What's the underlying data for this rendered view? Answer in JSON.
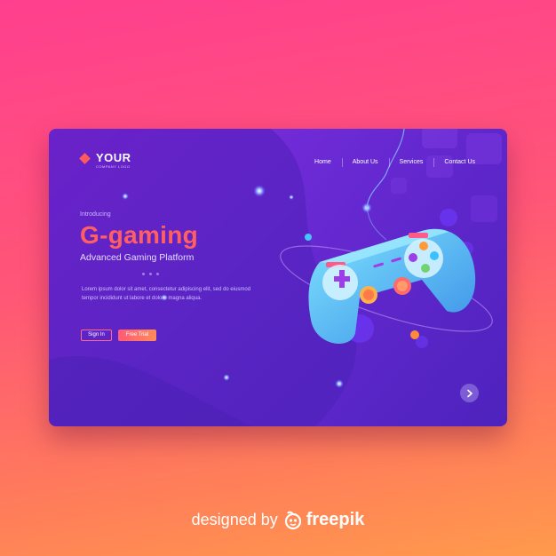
{
  "header": {
    "logo_text": "YOUR",
    "logo_subtext": "COMPANY LOGO",
    "nav": [
      "Home",
      "About Us",
      "Services",
      "Contact Us"
    ]
  },
  "hero": {
    "intro": "Introducing",
    "title": "G-gaming",
    "subtitle": "Advanced Gaming Platform",
    "body": "Lorem ipsum dolor sit amet, consectetur adipiscing elit, sed do eiusmod tempor incididunt ut labore et dolore magna aliqua.",
    "signin_label": "Sign In",
    "trial_label": "Free Trial"
  },
  "icons": {
    "next": "chevron-right-icon",
    "controller": "gamepad-icon",
    "brand_logo": "freepik-logo-icon"
  },
  "footer": {
    "designed_by": "designed by",
    "brand": "freepik"
  },
  "colors": {
    "accent": "#ff5f61",
    "card_bg": "#5a24c4",
    "controller": "#4cc6f2"
  }
}
